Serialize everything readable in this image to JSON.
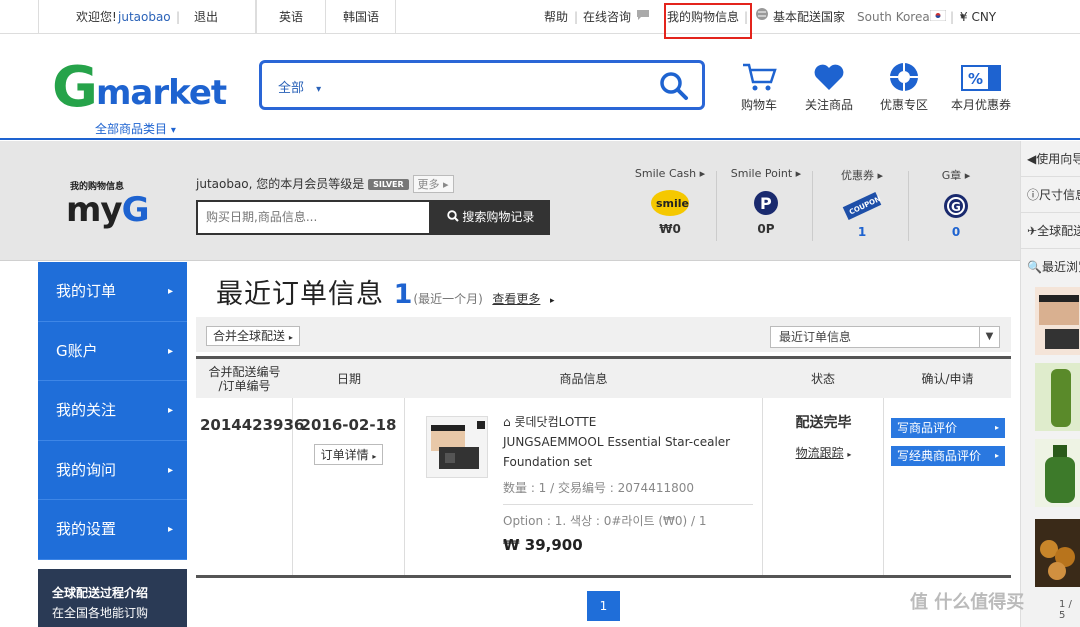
{
  "top": {
    "welcome": "欢迎您!",
    "username": "jutaobao",
    "logout": "退出",
    "lang_en": "英语",
    "lang_kr": "韩国语",
    "help": "帮助",
    "chat": "在线咨询",
    "my_shopping": "我的购物信息",
    "ship_country_label": "基本配送国家",
    "country": "South Korea",
    "currency": "¥ CNY"
  },
  "header": {
    "logo_g": "G",
    "logo_market": "market",
    "all_categories": "全部商品类目",
    "search_scope": "全部",
    "icons": [
      {
        "name": "cart-icon",
        "label": "购物车"
      },
      {
        "name": "heart-icon",
        "label": "关注商品"
      },
      {
        "name": "discount-zone-icon",
        "label": "优惠专区"
      },
      {
        "name": "coupon-percent-icon",
        "label": "本月优惠券"
      }
    ]
  },
  "myg": {
    "small_label": "我的购物信息",
    "logo_my": "my",
    "logo_g": "G",
    "member_text_user": "jutaobao",
    "member_text": ", 您的本月会员等级是",
    "member_level": "SILVER",
    "more": "更多",
    "search_placeholder": "购买日期,商品信息...",
    "search_button": "搜索购物记录",
    "stats": [
      {
        "label": "Smile Cash",
        "value": "₩0"
      },
      {
        "label": "Smile Point",
        "value": "0P"
      },
      {
        "label": "优惠券",
        "value": "1"
      },
      {
        "label": "G章",
        "value": "0"
      }
    ],
    "smile_icon_text": "smile",
    "coupon_icon_text": "COUPON"
  },
  "sidebar": {
    "items": [
      "我的订单",
      "G账户",
      "我的关注",
      "我的询问",
      "我的设置"
    ],
    "bottom_title": "全球配送过程介绍",
    "bottom_text": "在全国各地能订购"
  },
  "orders": {
    "title": "最近订单信息",
    "count": "1",
    "period": "(最近一个月)",
    "view_more": "查看更多",
    "filter_button": "合并全球配送",
    "filter_select": "最近订单信息",
    "columns": {
      "order_no": "合并配送编号\n/订单编号",
      "date": "日期",
      "product": "商品信息",
      "status": "状态",
      "action": "确认/申请"
    },
    "row": {
      "order_no": "2014423936",
      "date": "2016-02-18",
      "detail_button": "订单详情",
      "seller": "롯데닷컴LOTTE",
      "product_name": "JUNGSAEMMOOL Essential Star-cealer Foundation set",
      "qty_trade": "数量 : 1 / 交易编号 : 2074411800",
      "option": "Option : 1. 색상 : 0#라이트 (₩0) / 1",
      "price": "₩ 39,900",
      "status": "配送完毕",
      "track": "物流跟踪",
      "review_button": "写商品评价",
      "classic_review_button": "写经典商品评价"
    },
    "page": "1"
  },
  "right_panel": {
    "items": [
      "使用向导",
      "尺寸信息",
      "全球配送",
      "最近浏览"
    ],
    "pager": "1 / 5"
  },
  "watermark": "值 什么值得买",
  "colors": {
    "brand_blue": "#1e63d0",
    "brand_green": "#26a34a",
    "highlight_red": "#e3241c"
  }
}
